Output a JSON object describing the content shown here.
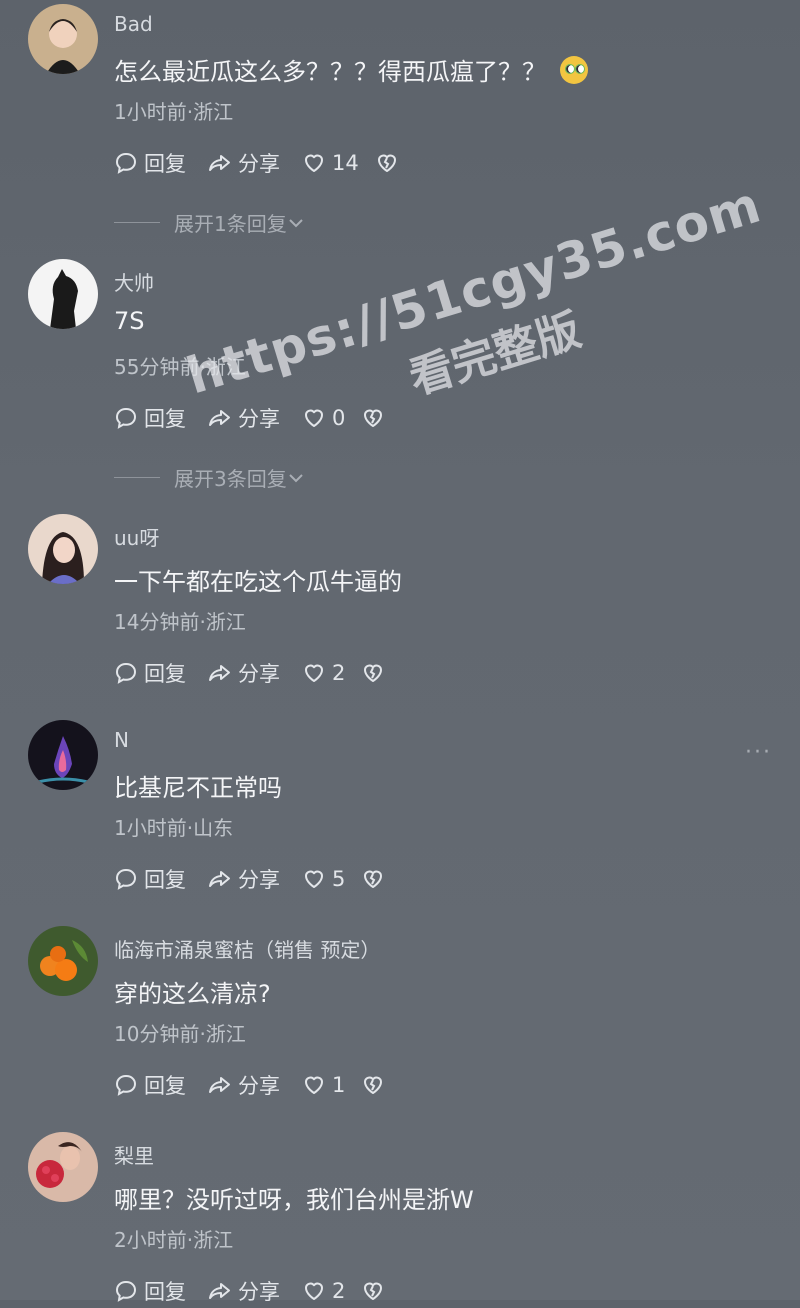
{
  "comments": [
    {
      "username": "Bad",
      "text": "怎么最近瓜这么多？？？得西瓜瘟了？？",
      "emoji": "rolling-eyes-emoji",
      "time": "1小时前·浙江",
      "reply_label": "回复",
      "share_label": "分享",
      "likes": "14",
      "expand": "展开1条回复"
    },
    {
      "username": "大帅",
      "text": "7S",
      "time": "55分钟前·浙江",
      "reply_label": "回复",
      "share_label": "分享",
      "likes": "0",
      "expand": "展开3条回复"
    },
    {
      "username": "uu呀",
      "text": "一下午都在吃这个瓜牛逼的",
      "time": "14分钟前·浙江",
      "reply_label": "回复",
      "share_label": "分享",
      "likes": "2"
    },
    {
      "username": "N",
      "text": "比基尼不正常吗",
      "time": "1小时前·山东",
      "reply_label": "回复",
      "share_label": "分享",
      "likes": "5",
      "more": "···"
    },
    {
      "username": "临海市涌泉蜜桔（销售 预定）",
      "text": "穿的这么清凉?",
      "time": "10分钟前·浙江",
      "reply_label": "回复",
      "share_label": "分享",
      "likes": "1"
    },
    {
      "username": "梨里",
      "text": "哪里？没听过呀，我们台州是浙W",
      "time": "2小时前·浙江",
      "reply_label": "回复",
      "share_label": "分享",
      "likes": "2"
    }
  ],
  "watermark": {
    "url": "https://51cgy35.com",
    "sub": "看完整版"
  },
  "colors": {
    "background": "#60666e",
    "text": "#f4f5f7",
    "meta": "#bfc4ca"
  }
}
